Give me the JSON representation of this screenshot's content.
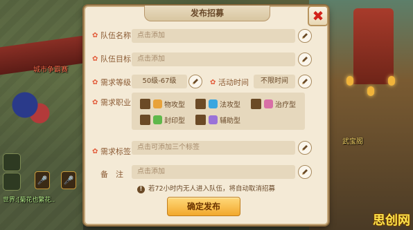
{
  "background": {
    "texts": [
      "城市争霸赛",
      "武宝阁"
    ],
    "chat_fragment": "世界:[菊花也繁花.."
  },
  "dialog": {
    "title": "发布招募",
    "close_icon": "close-x-icon",
    "fields": {
      "team_name": {
        "label": "队伍名称",
        "placeholder": "点击添加",
        "required": true
      },
      "team_goal": {
        "label": "队伍目标",
        "placeholder": "点击添加",
        "required": true
      },
      "level": {
        "label": "需求等级",
        "value": "50级-67级",
        "required": true
      },
      "active_time": {
        "label": "活动时间",
        "value": "不限时间",
        "required": true
      },
      "jobs": {
        "label": "需求职业",
        "required": true,
        "options": [
          "物攻型",
          "法攻型",
          "治疗型",
          "封印型",
          "辅助型"
        ]
      },
      "tags": {
        "label": "需求标签",
        "placeholder": "点击可添加三个标签",
        "required": true
      },
      "remark": {
        "label": "备　注",
        "placeholder": "点击添加",
        "required": false
      }
    },
    "note": "若72小时内无人进入队伍，将自动取消招募",
    "submit_label": "确定发布"
  },
  "colors": {
    "accent": "#f2a82c",
    "panel": "#f4ead6",
    "label": "#8a5a33",
    "close": "#d2231b"
  },
  "watermark": "思创网"
}
